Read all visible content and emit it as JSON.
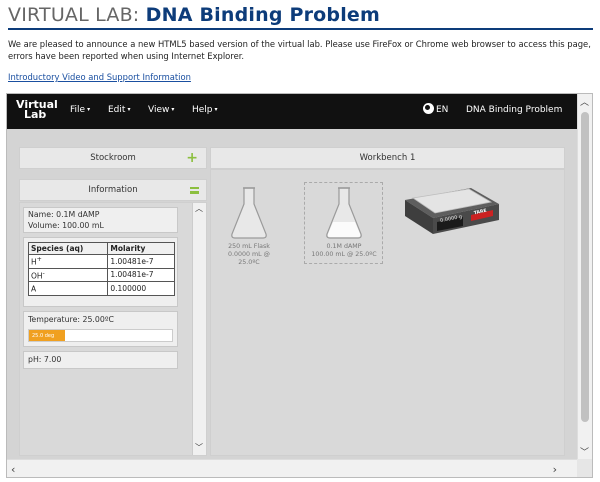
{
  "header": {
    "title_main": "VIRTUAL LAB:",
    "title_sub": "DNA Binding Problem",
    "notice": "We are pleased to announce a new HTML5 based version of the virtual lab. Please use FireFox or Chrome web browser to access this page, errors have been reported when using Internet Explorer.",
    "intro_link": "Introductory Video and Support Information"
  },
  "navbar": {
    "logo_line1": "Virtual",
    "logo_line2": "Lab",
    "menu": [
      {
        "label": "File"
      },
      {
        "label": "Edit"
      },
      {
        "label": "View"
      },
      {
        "label": "Help"
      }
    ],
    "language": "EN",
    "problem_title": "DNA Binding Problem"
  },
  "stockroom": {
    "title": "Stockroom"
  },
  "information": {
    "title": "Information",
    "name_line": "Name: 0.1M dAMP",
    "volume_line": "Volume: 100.00 mL",
    "table": {
      "headers": [
        "Species (aq)",
        "Molarity"
      ],
      "rows": [
        {
          "species": "H",
          "sup": "+",
          "molarity": "1.00481e-7"
        },
        {
          "species": "OH",
          "sup": "-",
          "molarity": "1.00481e-7"
        },
        {
          "species": "A",
          "sup": "",
          "molarity": "0.100000"
        }
      ]
    },
    "temperature_line": "Temperature: 25.00ºC",
    "temperature_bar_label": "25.0 deg",
    "temperature_fraction": 0.25,
    "ph_line": "pH: 7.00"
  },
  "workbench": {
    "title": "Workbench 1",
    "flasks": [
      {
        "name": "250 mL Flask",
        "detail": "0.0000 mL @ 25.0ºC",
        "fill": 0.0
      },
      {
        "name": "0.1M dAMP",
        "detail": "100.00 mL @ 25.0ºC",
        "fill": 0.4
      }
    ],
    "balance": {
      "reading": "0.0000 g",
      "tare_label": "TARE"
    }
  },
  "colors": {
    "title_blue": "#0d3c7a",
    "navbar": "#111111",
    "accent_green": "#8cbf3f",
    "temp_orange": "#f0a020",
    "balance_display": "#1a1a1a",
    "tare_red": "#cc2222"
  }
}
